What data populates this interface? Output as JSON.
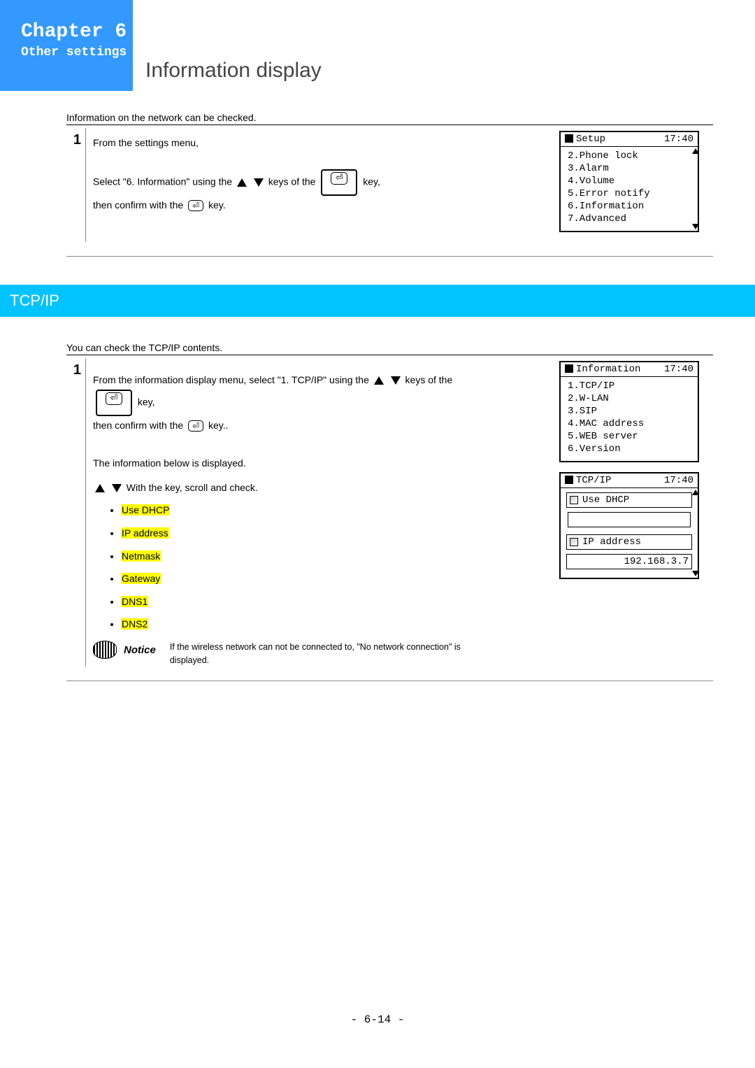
{
  "header": {
    "chapter": "Chapter 6",
    "subtitle": "Other settings",
    "pageTitle": "Information display"
  },
  "section1": {
    "intro": "Information on the network can be checked.",
    "step1": {
      "num": "1",
      "lineA": "From the settings menu,",
      "lineB_pre": "Select \"6. Information\" using the ",
      "lineB_mid": " keys of the ",
      "lineB_post": " key,",
      "lineC_pre": "then confirm with the ",
      "lineC_post": " key."
    },
    "screen1": {
      "title": "Setup",
      "time": "17:40",
      "items": [
        "2.Phone lock",
        "3.Alarm",
        "4.Volume",
        "5.Error notify",
        "6.Information",
        "7.Advanced"
      ],
      "selectedIndex": 4
    }
  },
  "tcpip": {
    "title": "TCP/IP",
    "intro": "You can check the TCP/IP contents.",
    "step1": {
      "num": "1",
      "pA_pre": "From the information display menu, select \"1. TCP/IP\" using the ",
      "pA_post": " keys of the",
      "pB_pre": " key,",
      "pC_pre": "then confirm with the ",
      "pC_post": " key..",
      "dispLine": "The information below is displayed.",
      "scrollLine_pre": "With the   key, scroll and check.",
      "bullets": [
        "Use DHCP",
        "IP address",
        "Netmask",
        "Gateway",
        "DNS1",
        "DNS2"
      ],
      "noticeLabel": "Notice",
      "noticeText": "If the wireless network can not be connected to, \"No network connection\" is displayed."
    },
    "screenInfo": {
      "title": "Information",
      "time": "17:40",
      "items": [
        "1.TCP/IP",
        "2.W-LAN",
        "3.SIP",
        "4.MAC address",
        "5.WEB server",
        "6.Version"
      ],
      "selectedIndex": 0
    },
    "screenTcp": {
      "title": "TCP/IP",
      "time": "17:40",
      "row1": "Use DHCP",
      "row2": "IP address",
      "ipValue": "192.168.3.7"
    }
  },
  "footer": "- 6-14 -"
}
